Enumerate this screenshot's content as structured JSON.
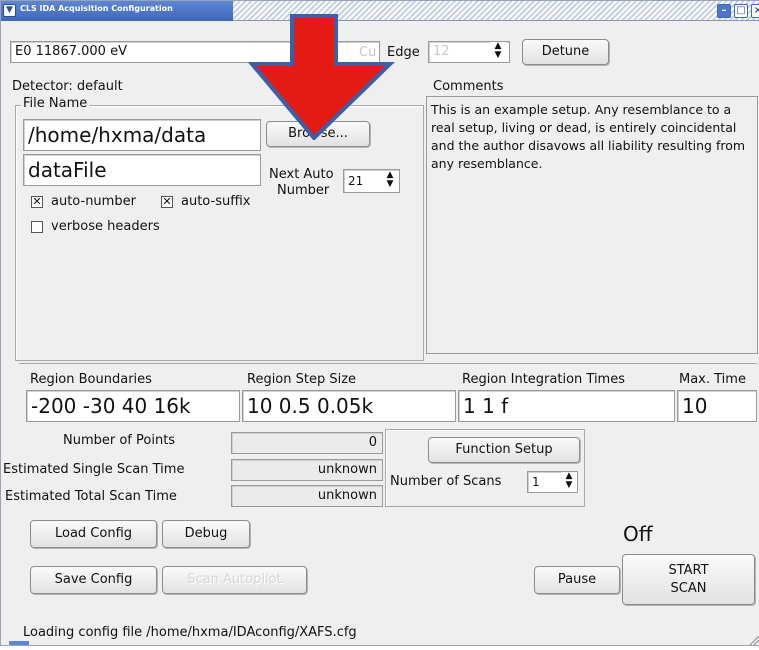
{
  "window": {
    "title": "CLS IDA Acquisition Configuration"
  },
  "energy": {
    "e0_label": "E0",
    "e0_value": "11867.000 eV",
    "element": "Cu",
    "edge_label": "Edge",
    "edge_value": "12",
    "detune_label": "Detune"
  },
  "detector": {
    "label": "Detector: default"
  },
  "file_name": {
    "group_label": "File Name",
    "path_value": "/home/hxma/data",
    "browse_label": "Browse...",
    "name_value": "dataFile",
    "next_auto_label": "Next Auto",
    "number_label": "Number",
    "next_auto_value": "21",
    "auto_number_label": "auto-number",
    "auto_number_checked": true,
    "auto_suffix_label": "auto-suffix",
    "auto_suffix_checked": true,
    "verbose_headers_label": "verbose headers",
    "verbose_headers_checked": false
  },
  "comments": {
    "label": "Comments",
    "text": "This is an example setup. Any resemblance to a real setup, living or dead, is entirely coincidental and the author disavows all liability resulting from any resemblance."
  },
  "regions": {
    "boundaries_label": "Region Boundaries",
    "boundaries_value": "-200 -30 40 16k",
    "step_size_label": "Region Step Size",
    "step_size_value": "10 0.5 0.05k",
    "integration_label": "Region Integration Times",
    "integration_value": "1 1 f",
    "max_time_label": "Max. Time",
    "max_time_value": "10"
  },
  "stats": {
    "points_label": "Number of Points",
    "points_value": "0",
    "single_time_label": "Estimated Single Scan Time",
    "single_time_value": "unknown",
    "total_time_label": "Estimated Total Scan Time",
    "total_time_value": "unknown"
  },
  "function": {
    "setup_label": "Function Setup",
    "num_scans_label": "Number of Scans",
    "num_scans_value": "1"
  },
  "actions": {
    "load_config": "Load Config",
    "debug": "Debug",
    "save_config": "Save Config",
    "scan_autopilot": "Scan Autopilot",
    "status": "Off",
    "pause": "Pause",
    "start_scan_line1": "START",
    "start_scan_line2": "SCAN"
  },
  "statusbar": {
    "message": "Loading config file /home/hxma/IDAconfig/XAFS.cfg"
  },
  "annotation": {
    "arrow_color": "#e31b12",
    "arrow_outline": "#3b5fa8"
  }
}
